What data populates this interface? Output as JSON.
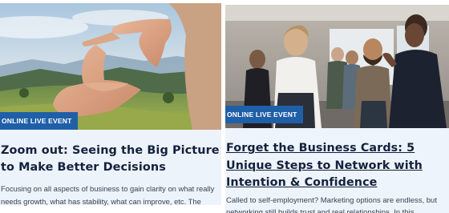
{
  "cards": [
    {
      "badge": "ONLINE LIVE EVENT",
      "title": "Zoom out: Seeing the Big Picture to Make Better Decisions",
      "description": "Focusing on all aspects of business to gain clarity on what really needs growth, what has stability, what can improve, etc. The",
      "image_alt": "hands framing a mountain landscape"
    },
    {
      "badge": "ONLINE LIVE EVENT",
      "title": "Forget the Business Cards: 5 Unique Steps to Network with Intention & Confidence",
      "description": "Called to self-employment? Marketing options are endless, but networking still builds trust and real relationships. In this",
      "image_alt": "people networking at an event"
    }
  ],
  "colors": {
    "badge_bg": "#1f5fa8",
    "title": "#14213d",
    "card_bg": "#edf3fa"
  }
}
